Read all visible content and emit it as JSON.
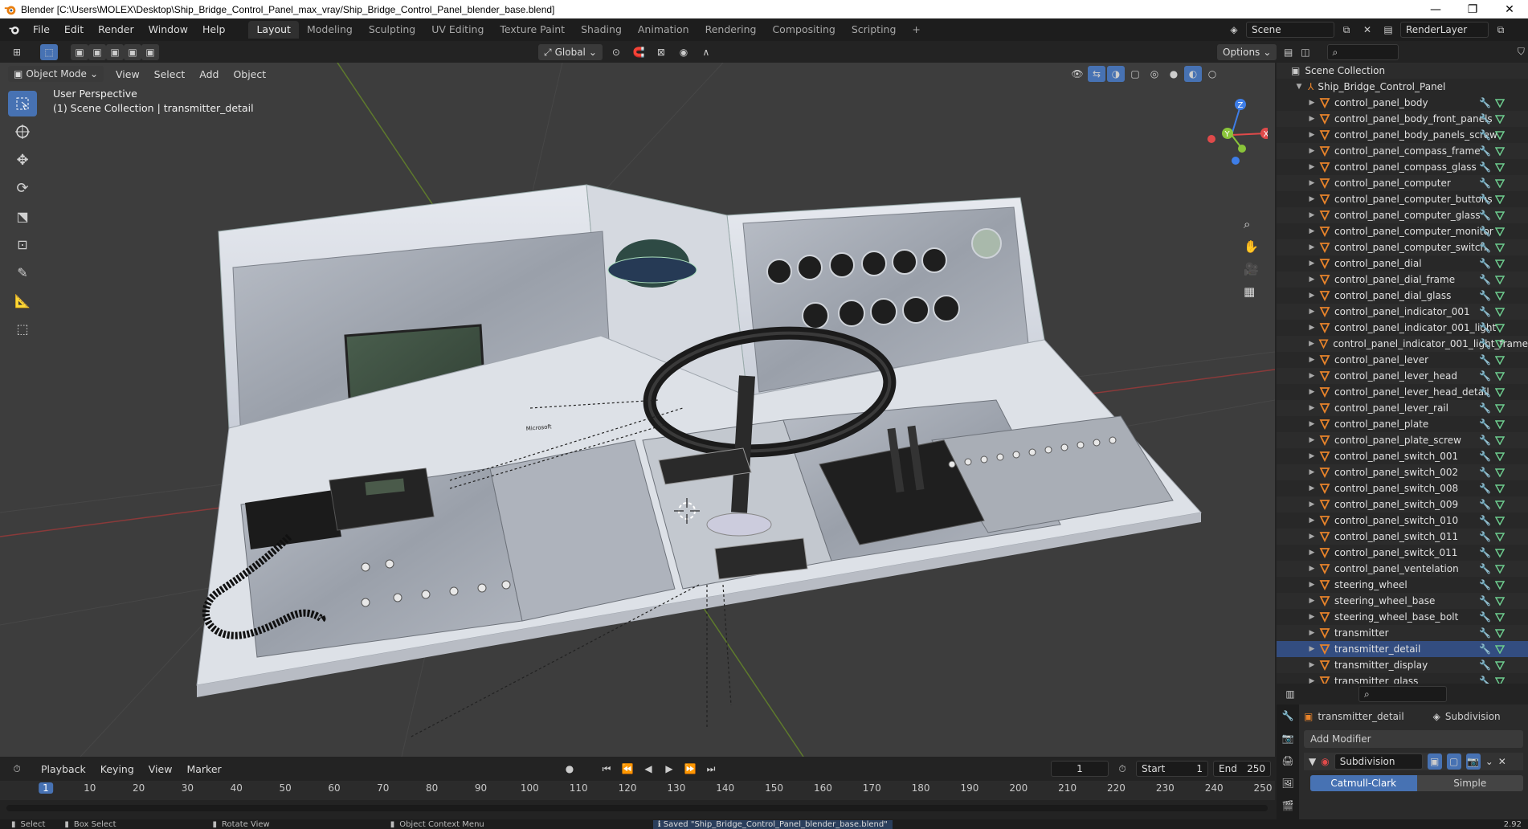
{
  "window": {
    "title": "Blender [C:\\Users\\MOLEX\\Desktop\\Ship_Bridge_Control_Panel_max_vray/Ship_Bridge_Control_Panel_blender_base.blend]",
    "minimize": "—",
    "maximize": "❐",
    "close": "✕"
  },
  "menu": [
    "File",
    "Edit",
    "Render",
    "Window",
    "Help"
  ],
  "workspaces": [
    "Layout",
    "Modeling",
    "Sculpting",
    "UV Editing",
    "Texture Paint",
    "Shading",
    "Animation",
    "Rendering",
    "Compositing",
    "Scripting"
  ],
  "workspace_add": "+",
  "scene": {
    "name": "Scene",
    "render_layer": "RenderLayer"
  },
  "viewport_header": {
    "transform_orientation": "Global",
    "options": "Options",
    "mode": "Object Mode",
    "menus": [
      "View",
      "Select",
      "Add",
      "Object"
    ]
  },
  "viewport": {
    "perspective": "User Perspective",
    "collection_info": "(1) Scene Collection | transmitter_detail",
    "axes": {
      "x": "X",
      "y": "Y",
      "z": "Z"
    },
    "brand_label": "Microsoft"
  },
  "timeline": {
    "menus": [
      "Playback",
      "Keying",
      "View",
      "Marker"
    ],
    "current_frame": "1",
    "start_label": "Start",
    "start": "1",
    "end_label": "End",
    "end": "250",
    "ticks": [
      "1",
      "10",
      "20",
      "30",
      "40",
      "50",
      "60",
      "70",
      "80",
      "90",
      "100",
      "110",
      "120",
      "130",
      "140",
      "150",
      "160",
      "170",
      "180",
      "190",
      "200",
      "210",
      "220",
      "230",
      "240",
      "250"
    ]
  },
  "statusbar": {
    "select": "Select",
    "box_select": "Box Select",
    "rotate_view": "Rotate View",
    "context_menu": "Object Context Menu",
    "message": "Saved \"Ship_Bridge_Control_Panel_blender_base.blend\"",
    "version": "2.92"
  },
  "outliner": {
    "root": "Scene Collection",
    "collection": "Ship_Bridge_Control_Panel",
    "items": [
      "control_panel_body",
      "control_panel_body_front_panels",
      "control_panel_body_panels_screw",
      "control_panel_compass_frame",
      "control_panel_compass_glass",
      "control_panel_computer",
      "control_panel_computer_buttons",
      "control_panel_computer_glass",
      "control_panel_computer_monitor",
      "control_panel_computer_switch",
      "control_panel_dial",
      "control_panel_dial_frame",
      "control_panel_dial_glass",
      "control_panel_indicator_001",
      "control_panel_indicator_001_light",
      "control_panel_indicator_001_light_frame",
      "control_panel_lever",
      "control_panel_lever_head",
      "control_panel_lever_head_detail",
      "control_panel_lever_rail",
      "control_panel_plate",
      "control_panel_plate_screw",
      "control_panel_switch_001",
      "control_panel_switch_002",
      "control_panel_switch_008",
      "control_panel_switch_009",
      "control_panel_switch_010",
      "control_panel_switch_011",
      "control_panel_switck_011",
      "control_panel_ventelation",
      "steering_wheel",
      "steering_wheel_base",
      "steering_wheel_base_bolt",
      "transmitter",
      "transmitter_detail",
      "transmitter_display",
      "transmitter_glass"
    ],
    "selected": "transmitter_detail"
  },
  "properties": {
    "object": "transmitter_detail",
    "modifier_name": "Subdivision",
    "add_modifier": "Add Modifier",
    "modifier_field": "Subdivision",
    "catmull": "Catmull-Clark",
    "simple": "Simple"
  },
  "colors": {
    "accent": "#4772b3",
    "selected_row": "#334d80",
    "object_orange": "#e8832a",
    "mesh_green": "#6dcc8e",
    "modifier_blue": "#80a8e8",
    "x_axis": "#e04a4a",
    "y_axis": "#8ac43a",
    "z_axis": "#3e7ee8"
  }
}
